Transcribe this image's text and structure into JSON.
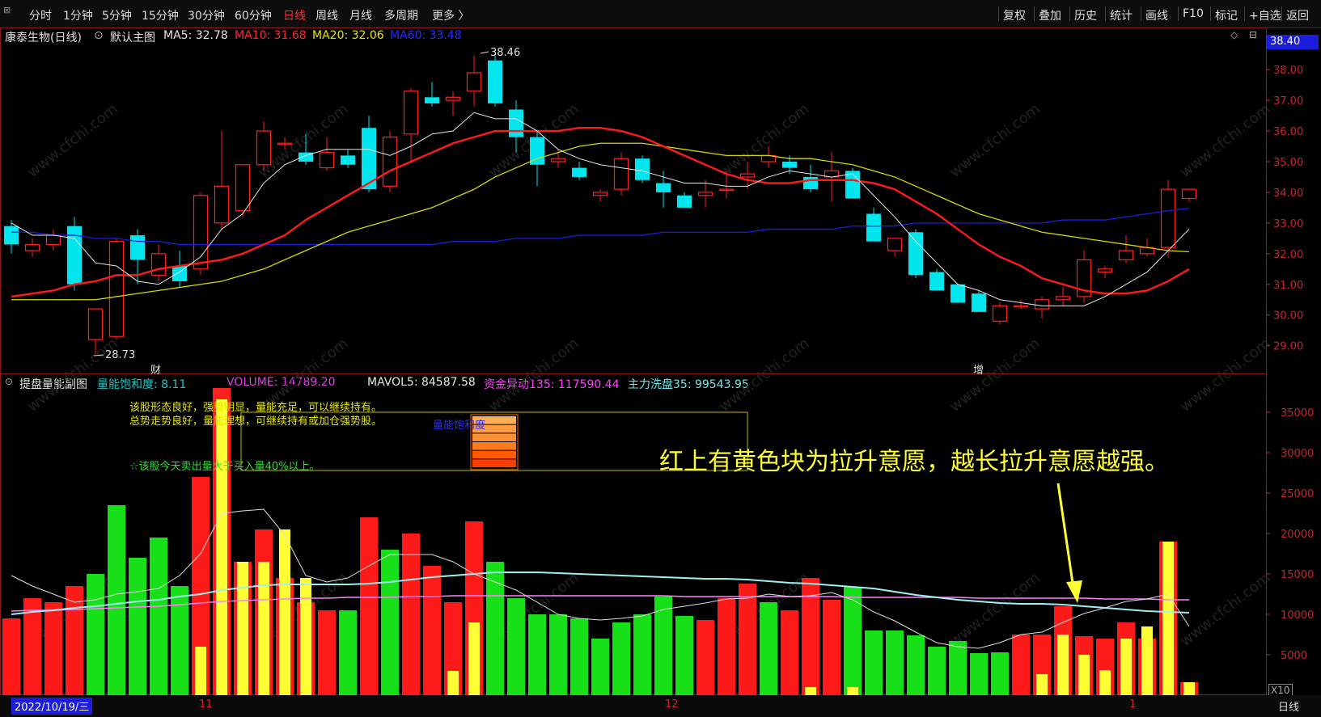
{
  "toolbar": {
    "left": [
      "分时",
      "1分钟",
      "5分钟",
      "15分钟",
      "30分钟",
      "60分钟",
      "日线",
      "周线",
      "月线",
      "多周期",
      "更多 〉"
    ],
    "active": "日线",
    "right": [
      "复权",
      "叠加",
      "历史",
      "统计",
      "画线",
      "F10",
      "标记",
      "+自选",
      "返回"
    ]
  },
  "main_header": {
    "stock": "康泰生物(日线)",
    "indicator": "默认主图",
    "ma5": "MA5: 32.78",
    "ma10": "MA10: 31.68",
    "ma20": "MA20: 32.06",
    "ma60": "MA60: 33.48",
    "price_box": "38.40",
    "high_label": "38.46",
    "low_label": "28.73",
    "marker_cai": "财",
    "marker_zeng": "增"
  },
  "sub_header": {
    "indicator": "提盘量能副图",
    "saturation": "量能饱和度: 8.11",
    "volume": "VOLUME: 14789.20",
    "mavol5": "MAVOL5: 84587.58",
    "fund135": "资金异动135: 117590.44",
    "wash35": "主力洗盘35: 99543.95"
  },
  "notes": {
    "line1": "该股形态良好，强势明显，量能充足，可以继续持有。",
    "line2": "总势走势良好，量能理想，可继续持有或加仓强势股。",
    "line3": "☆该股今天卖出量大于买入量40%以上。",
    "box_label": "量能饱和度",
    "annotation": "红上有黄色块为拉升意愿，越长拉升意愿越强。",
    "x10": "X10"
  },
  "bottom": {
    "date": "2022/10/19/三",
    "m11": "11",
    "m12": "12",
    "m1": "1",
    "period": "日线"
  },
  "watermark": "www.cfchi.com",
  "colors": {
    "up": "#ff2020",
    "down": "#00e5ee",
    "ma5": "#e6e6e6",
    "ma10": "#ff1a1a",
    "ma20": "#d6d600",
    "ma60": "#1c1cdc",
    "vol_up": "#ff1a1a",
    "vol_down": "#18e018",
    "vol_yellow": "#ffff33",
    "axis": "#c8242b"
  },
  "chart_data": [
    {
      "type": "candlestick",
      "ylim": [
        28.2,
        38.9
      ],
      "y_ticks": [
        29,
        30,
        31,
        32,
        33,
        34,
        35,
        36,
        37,
        38
      ],
      "x_tick_labels": [
        "2022/10/19/三",
        "11",
        "12",
        "1"
      ],
      "ohlc": [
        [
          32.9,
          33.1,
          32.0,
          32.3
        ],
        [
          32.1,
          32.5,
          31.9,
          32.3
        ],
        [
          32.3,
          32.8,
          32.1,
          32.6
        ],
        [
          32.9,
          33.2,
          30.8,
          31.0
        ],
        [
          29.2,
          30.2,
          28.73,
          30.2
        ],
        [
          29.3,
          32.5,
          29.2,
          32.4
        ],
        [
          32.6,
          32.8,
          31.0,
          31.8
        ],
        [
          31.3,
          32.3,
          31.1,
          32.0
        ],
        [
          31.6,
          32.1,
          30.9,
          31.1
        ],
        [
          31.5,
          34.0,
          31.3,
          33.9
        ],
        [
          33.0,
          36.0,
          32.8,
          34.2
        ],
        [
          33.4,
          34.7,
          33.2,
          34.9
        ],
        [
          34.9,
          36.3,
          34.7,
          36.0
        ],
        [
          35.6,
          35.8,
          35.4,
          35.6
        ],
        [
          35.3,
          35.9,
          34.9,
          35.0
        ],
        [
          34.8,
          35.8,
          34.7,
          35.3
        ],
        [
          35.2,
          35.4,
          34.8,
          34.9
        ],
        [
          36.1,
          36.5,
          34.0,
          34.1
        ],
        [
          34.2,
          36.0,
          34.0,
          35.8
        ],
        [
          35.9,
          37.4,
          35.0,
          37.3
        ],
        [
          37.1,
          37.6,
          36.8,
          36.9
        ],
        [
          37.0,
          37.3,
          36.5,
          37.1
        ],
        [
          37.3,
          38.46,
          36.8,
          37.9
        ],
        [
          38.3,
          38.5,
          36.8,
          36.9
        ],
        [
          36.7,
          37.0,
          35.3,
          35.8
        ],
        [
          35.8,
          36.0,
          34.2,
          34.9
        ],
        [
          35.0,
          35.4,
          34.8,
          35.1
        ],
        [
          34.8,
          35.0,
          34.4,
          34.5
        ],
        [
          33.9,
          34.1,
          33.7,
          34.0
        ],
        [
          34.1,
          35.3,
          33.9,
          35.1
        ],
        [
          35.1,
          35.2,
          34.3,
          34.4
        ],
        [
          34.3,
          34.7,
          33.5,
          34.0
        ],
        [
          33.9,
          34.0,
          33.5,
          33.5
        ],
        [
          33.9,
          34.4,
          33.5,
          34.0
        ],
        [
          34.1,
          34.7,
          33.8,
          34.1
        ],
        [
          34.5,
          35.0,
          34.1,
          34.6
        ],
        [
          35.0,
          35.5,
          34.8,
          35.2
        ],
        [
          35.0,
          35.2,
          34.6,
          34.8
        ],
        [
          34.5,
          34.9,
          34.0,
          34.1
        ],
        [
          34.5,
          35.3,
          33.7,
          34.7
        ],
        [
          34.7,
          34.8,
          33.8,
          33.8
        ],
        [
          33.3,
          33.5,
          32.4,
          32.4
        ],
        [
          32.1,
          32.5,
          31.9,
          32.5
        ],
        [
          32.7,
          32.8,
          31.2,
          31.3
        ],
        [
          31.4,
          31.5,
          30.8,
          30.8
        ],
        [
          31.0,
          31.0,
          30.4,
          30.4
        ],
        [
          30.7,
          30.8,
          30.1,
          30.1
        ],
        [
          29.8,
          30.4,
          29.7,
          30.3
        ],
        [
          30.3,
          30.5,
          30.2,
          30.3
        ],
        [
          30.2,
          30.6,
          29.9,
          30.5
        ],
        [
          30.5,
          30.9,
          30.3,
          30.6
        ],
        [
          30.6,
          32.1,
          30.4,
          31.8
        ],
        [
          31.4,
          31.6,
          31.2,
          31.5
        ],
        [
          31.8,
          32.6,
          31.7,
          32.1
        ],
        [
          32.0,
          32.5,
          31.9,
          32.2
        ],
        [
          32.2,
          34.4,
          31.9,
          34.1
        ],
        [
          33.8,
          34.1,
          33.7,
          34.1
        ]
      ],
      "ma5": [
        33.0,
        32.6,
        32.6,
        32.5,
        31.7,
        31.6,
        31.1,
        31.0,
        31.4,
        31.9,
        32.8,
        33.3,
        34.3,
        34.9,
        35.2,
        35.4,
        35.4,
        35.4,
        35.2,
        35.5,
        35.9,
        36.0,
        36.6,
        36.4,
        36.4,
        36.0,
        35.4,
        35.1,
        34.9,
        34.8,
        34.7,
        34.5,
        34.3,
        34.3,
        34.2,
        34.2,
        34.5,
        34.7,
        34.6,
        34.5,
        34.6,
        33.9,
        33.2,
        32.4,
        31.7,
        31.0,
        30.8,
        30.5,
        30.4,
        30.3,
        30.3,
        30.3,
        30.6,
        31.0,
        31.4,
        32.1,
        32.8
      ],
      "ma10": [
        30.6,
        30.7,
        30.8,
        31.0,
        31.1,
        31.3,
        31.3,
        31.5,
        31.6,
        31.7,
        31.8,
        32.0,
        32.3,
        32.6,
        33.1,
        33.5,
        33.9,
        34.3,
        34.7,
        35.0,
        35.3,
        35.6,
        35.8,
        36.0,
        36.0,
        36.0,
        36.0,
        36.1,
        36.1,
        36.0,
        35.8,
        35.5,
        35.2,
        34.9,
        34.6,
        34.4,
        34.3,
        34.3,
        34.4,
        34.4,
        34.4,
        34.3,
        34.1,
        33.7,
        33.3,
        32.8,
        32.3,
        31.9,
        31.6,
        31.2,
        31.0,
        30.8,
        30.7,
        30.7,
        30.8,
        31.1,
        31.5
      ],
      "ma20": [
        30.5,
        30.5,
        30.5,
        30.5,
        30.5,
        30.6,
        30.7,
        30.8,
        30.9,
        31.0,
        31.1,
        31.3,
        31.5,
        31.8,
        32.1,
        32.4,
        32.7,
        32.9,
        33.1,
        33.3,
        33.5,
        33.8,
        34.1,
        34.5,
        34.8,
        35.1,
        35.3,
        35.5,
        35.6,
        35.6,
        35.6,
        35.5,
        35.4,
        35.3,
        35.2,
        35.2,
        35.2,
        35.1,
        35.1,
        35.0,
        34.9,
        34.7,
        34.5,
        34.2,
        33.9,
        33.6,
        33.3,
        33.1,
        32.9,
        32.7,
        32.6,
        32.5,
        32.4,
        32.3,
        32.2,
        32.1,
        32.06
      ],
      "ma60": [
        32.7,
        32.7,
        32.6,
        32.6,
        32.5,
        32.5,
        32.4,
        32.4,
        32.3,
        32.3,
        32.3,
        32.3,
        32.3,
        32.3,
        32.3,
        32.3,
        32.3,
        32.3,
        32.3,
        32.3,
        32.3,
        32.4,
        32.4,
        32.4,
        32.5,
        32.5,
        32.5,
        32.6,
        32.6,
        32.6,
        32.6,
        32.7,
        32.7,
        32.7,
        32.7,
        32.7,
        32.8,
        32.8,
        32.8,
        32.8,
        32.9,
        32.9,
        32.9,
        33.0,
        33.0,
        33.0,
        33.0,
        33.0,
        33.0,
        33.0,
        33.1,
        33.1,
        33.1,
        33.2,
        33.3,
        33.4,
        33.48
      ]
    },
    {
      "type": "bar",
      "ylim": [
        0,
        38000
      ],
      "y_ticks": [
        5000,
        10000,
        15000,
        20000,
        25000,
        30000,
        35000
      ],
      "volume": [
        9500,
        12000,
        11500,
        13500,
        15000,
        23500,
        17000,
        19500,
        13500,
        27000,
        38000,
        16500,
        20500,
        14500,
        11500,
        10500,
        10500,
        22000,
        18000,
        20000,
        16000,
        11500,
        21500,
        16500,
        12000,
        10000,
        10000,
        9500,
        7000,
        9000,
        10000,
        12200,
        9800,
        9300,
        12000,
        13800,
        11500,
        10500,
        14500,
        11800,
        13400,
        8000,
        8000,
        7400,
        6000,
        6700,
        5200,
        5300,
        7500,
        7500,
        11000,
        7300,
        7000,
        9000,
        7000,
        19000,
        1600
      ],
      "dir": [
        "r",
        "r",
        "r",
        "r",
        "g",
        "g",
        "g",
        "g",
        "g",
        "r",
        "r",
        "r",
        "r",
        "r",
        "r",
        "r",
        "g",
        "r",
        "g",
        "r",
        "r",
        "r",
        "r",
        "g",
        "g",
        "g",
        "g",
        "g",
        "g",
        "g",
        "g",
        "g",
        "g",
        "r",
        "r",
        "r",
        "g",
        "r",
        "r",
        "r",
        "g",
        "g",
        "g",
        "g",
        "g",
        "g",
        "g",
        "g",
        "r",
        "r",
        "r",
        "r",
        "r",
        "r",
        "r",
        "r",
        "r"
      ],
      "yellow": [
        0,
        0,
        0,
        0,
        0,
        0,
        0,
        0,
        0,
        6000,
        38000,
        16500,
        16500,
        20500,
        14500,
        0,
        0,
        0,
        0,
        0,
        0,
        3000,
        9000,
        0,
        0,
        0,
        0,
        0,
        0,
        0,
        0,
        0,
        0,
        0,
        0,
        0,
        0,
        0,
        1000,
        0,
        1000,
        0,
        0,
        0,
        0,
        0,
        0,
        0,
        0,
        2600,
        7500,
        5000,
        3100,
        7000,
        8500,
        19000,
        1600
      ],
      "mavol_white": [
        14800,
        13500,
        12500,
        11500,
        11800,
        12500,
        12800,
        13200,
        14800,
        17500,
        22500,
        22800,
        23000,
        19800,
        14800,
        14000,
        14500,
        16000,
        17400,
        17400,
        17400,
        16500,
        15000,
        14000,
        13000,
        11500,
        10000,
        9500,
        9300,
        9500,
        9800,
        10600,
        11000,
        11400,
        11900,
        12000,
        12500,
        12200,
        12300,
        12700,
        11800,
        10300,
        9200,
        7800,
        6500,
        6000,
        5800,
        6500,
        7500,
        7800,
        9000,
        10100,
        10800,
        11600,
        11900,
        12500,
        8500
      ],
      "mavol_cyan": [
        10000,
        10300,
        10500,
        10800,
        11000,
        11300,
        11600,
        11800,
        12200,
        12500,
        13000,
        13300,
        13600,
        13700,
        13700,
        13700,
        13700,
        13800,
        14000,
        14300,
        14600,
        14800,
        15000,
        15200,
        15200,
        15200,
        15100,
        15000,
        14900,
        14800,
        14700,
        14600,
        14500,
        14400,
        14400,
        14300,
        14100,
        13900,
        13800,
        13600,
        13400,
        13200,
        12800,
        12400,
        12100,
        11800,
        11600,
        11400,
        11300,
        11300,
        11200,
        11000,
        10800,
        10600,
        10400,
        10300,
        10200
      ],
      "mavol_pink": [
        10400,
        10500,
        10500,
        10600,
        10700,
        10800,
        10900,
        11000,
        11200,
        11400,
        11600,
        11700,
        11800,
        11900,
        12000,
        12000,
        12100,
        12100,
        12100,
        12200,
        12200,
        12300,
        12300,
        12300,
        12300,
        12300,
        12300,
        12300,
        12300,
        12300,
        12300,
        12300,
        12200,
        12200,
        12200,
        12200,
        12200,
        12200,
        12200,
        12200,
        12100,
        12100,
        12100,
        12100,
        12100,
        12100,
        12000,
        12000,
        12000,
        12000,
        12000,
        12000,
        11900,
        11900,
        11900,
        11800,
        11800
      ]
    }
  ]
}
